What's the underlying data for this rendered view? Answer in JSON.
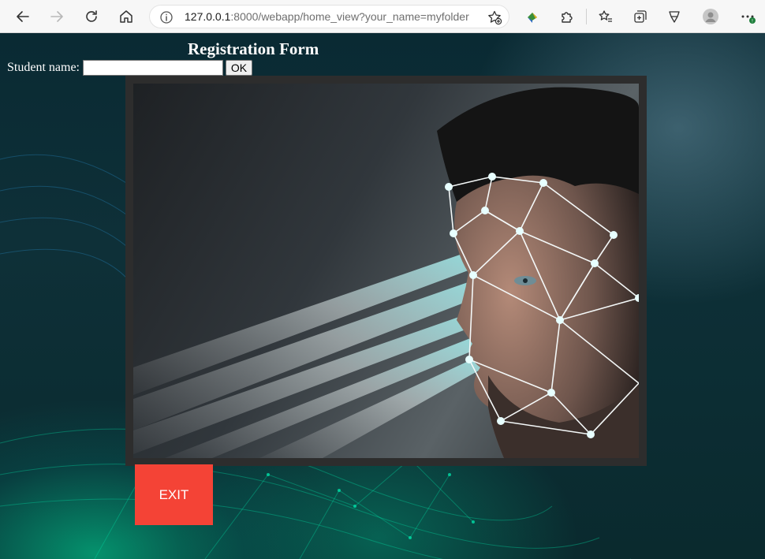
{
  "browser": {
    "url_host": "127.0.0.1",
    "url_path": ":8000/webapp/home_view?your_name=myfolder"
  },
  "form": {
    "title": "Registration Form",
    "student_label": "Student name:",
    "student_value": "",
    "ok_label": "OK",
    "exit_label": "EXIT"
  },
  "colors": {
    "exit_button": "#f44336",
    "frame": "#2d2d2d",
    "accent_teal": "#00d6a8"
  },
  "icons": [
    "back-icon",
    "forward-icon",
    "refresh-icon",
    "home-icon",
    "info-icon",
    "favorite-add-icon",
    "extension-icon",
    "puzzle-icon",
    "favorites-icon",
    "collections-icon",
    "browser-essentials-icon",
    "profile-icon",
    "more-icon"
  ]
}
